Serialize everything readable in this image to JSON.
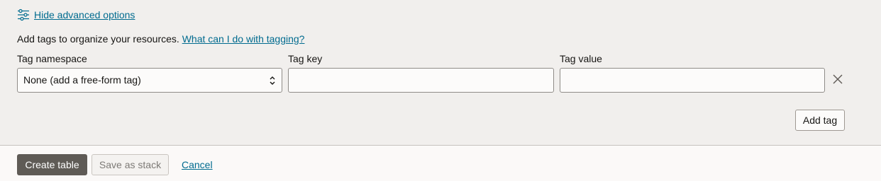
{
  "advanced": {
    "toggle_label": "Hide advanced options",
    "icon": "sliders-icon"
  },
  "tags": {
    "intro_text": "Add tags to organize your resources.",
    "help_link": "What can I do with tagging?",
    "namespace_label": "Tag namespace",
    "namespace_value": "None (add a free-form tag)",
    "key_label": "Tag key",
    "key_value": "",
    "value_label": "Tag value",
    "value_value": "",
    "remove_icon": "close-icon",
    "add_tag_label": "Add tag"
  },
  "footer": {
    "create_label": "Create table",
    "save_stack_label": "Save as stack",
    "cancel_label": "Cancel"
  },
  "colors": {
    "link": "#006b8f",
    "primary_button": "#5f5b56",
    "panel_background": "#f1efed"
  }
}
